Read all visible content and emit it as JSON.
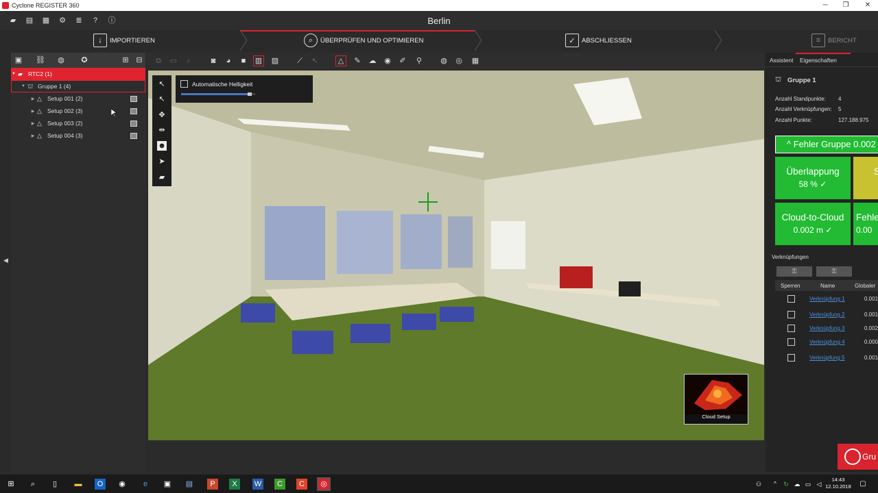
{
  "window": {
    "title": "Cyclone REGISTER 360",
    "minimize": "─",
    "maximize": "❐",
    "close": "✕"
  },
  "menubar": {
    "project_name": "Berlin",
    "icons": [
      "folder-open-icon",
      "folder-icon",
      "list-icon",
      "gear-icon",
      "layers-icon",
      "help-icon",
      "info-icon"
    ]
  },
  "workflow": {
    "steps": [
      {
        "label": "IMPORTIEREN",
        "state": "done"
      },
      {
        "label": "ÜBERPRÜFEN UND OPTIMIEREN",
        "state": "active"
      },
      {
        "label": "ABSCHLIESSEN",
        "state": "pending"
      },
      {
        "label": "BERICHT",
        "state": "disabled"
      }
    ],
    "accent": "#d9232e"
  },
  "tree": {
    "root": {
      "label": "RTC2 (1)"
    },
    "group": {
      "label": "Gruppe 1 (4)"
    },
    "setups": [
      {
        "label": "Setup 001 (2)"
      },
      {
        "label": "Setup 002 (3)"
      },
      {
        "label": "Setup 003 (2)"
      },
      {
        "label": "Setup 004 (3)"
      }
    ]
  },
  "viewport": {
    "auto_brightness_label": "Automatische Helligkeit",
    "auto_brightness_checked": false,
    "brightness_level": 0.9,
    "cloud_setup_label": "Cloud Setup"
  },
  "right": {
    "tabs": [
      "Assistent",
      "Eigenschaften"
    ],
    "group_title": "Gruppe 1",
    "stats": [
      {
        "label": "Anzahl Standpunkte:",
        "value": "4"
      },
      {
        "label": "Anzahl Verknüpfungen:",
        "value": "5"
      },
      {
        "label": "Anzahl Punkte:",
        "value": "127.188.975"
      }
    ],
    "error_bar": "^ Fehler Gruppe 0.002",
    "tiles": [
      {
        "title": "Überlappung",
        "value": "58 %  ✓"
      },
      {
        "title": "S",
        "value": ""
      },
      {
        "title": "Cloud-to-Cloud",
        "value": "0.002 m   ✓"
      },
      {
        "title": "Fehle",
        "value": "0.00"
      }
    ],
    "links_heading": "Verknüpfungen",
    "table_headers": [
      "Sperren",
      "Name",
      "Globaler"
    ],
    "links": [
      {
        "name": "Verknüpfung 1",
        "value": "0.001"
      },
      {
        "name": "Verknüpfung 2",
        "value": "0.001"
      },
      {
        "name": "Verknüpfung 3",
        "value": "0.002"
      },
      {
        "name": "Verknüpfung 4",
        "value": "0.000"
      },
      {
        "name": "Verknüpfung 5",
        "value": "0.001"
      }
    ],
    "bottom_button": "Gru"
  },
  "taskbar": {
    "time": "14:43",
    "date": "12.10.2018"
  }
}
